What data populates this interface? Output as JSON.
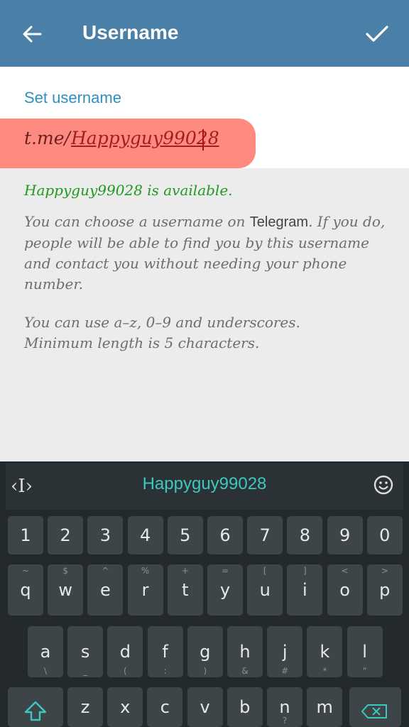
{
  "header": {
    "title": "Username",
    "back_icon": "arrow-left-icon",
    "done_icon": "check-icon"
  },
  "form": {
    "label": "Set username",
    "prefix": "t.me/",
    "value": "Happyguy99028",
    "status": "Happyguy99028 is available.",
    "info_1_a": "You can choose a username on ",
    "info_1_brand": "Telegram",
    "info_1_b": ". If you do, people will be able to find you by this username and contact you without needing your phone number.",
    "info_2": "You can use a–z, 0–9 and underscores. Minimum length is 5 characters."
  },
  "keyboard": {
    "suggestion": "Happyguy99028",
    "cursor_tool": "‹I›",
    "emoji_icon": "smiley-icon",
    "numbers": [
      "1",
      "2",
      "3",
      "4",
      "5",
      "6",
      "7",
      "8",
      "9",
      "0"
    ],
    "row1": [
      {
        "k": "q",
        "s": "~"
      },
      {
        "k": "w",
        "s": "$"
      },
      {
        "k": "e",
        "s": "^"
      },
      {
        "k": "r",
        "s": "%"
      },
      {
        "k": "t",
        "s": "+"
      },
      {
        "k": "y",
        "s": "="
      },
      {
        "k": "u",
        "s": "["
      },
      {
        "k": "i",
        "s": "]"
      },
      {
        "k": "o",
        "s": "<"
      },
      {
        "k": "p",
        "s": ">"
      }
    ],
    "row2": [
      {
        "k": "a",
        "s": "\\"
      },
      {
        "k": "s",
        "s": "_"
      },
      {
        "k": "d",
        "s": "("
      },
      {
        "k": "f",
        "s": ":"
      },
      {
        "k": "g",
        "s": ")"
      },
      {
        "k": "h",
        "s": "&"
      },
      {
        "k": "j",
        "s": "#"
      },
      {
        "k": "k",
        "s": "*"
      },
      {
        "k": "l",
        "s": "\""
      }
    ],
    "row3": [
      {
        "k": "z",
        "s": ""
      },
      {
        "k": "x",
        "s": ""
      },
      {
        "k": "c",
        "s": ""
      },
      {
        "k": "v",
        "s": ""
      },
      {
        "k": "b",
        "s": ""
      },
      {
        "k": "n",
        "s": "?"
      },
      {
        "k": "m",
        "s": ""
      }
    ],
    "shift_icon": "shift-up-arrow-icon",
    "backspace_icon": "backspace-icon"
  }
}
